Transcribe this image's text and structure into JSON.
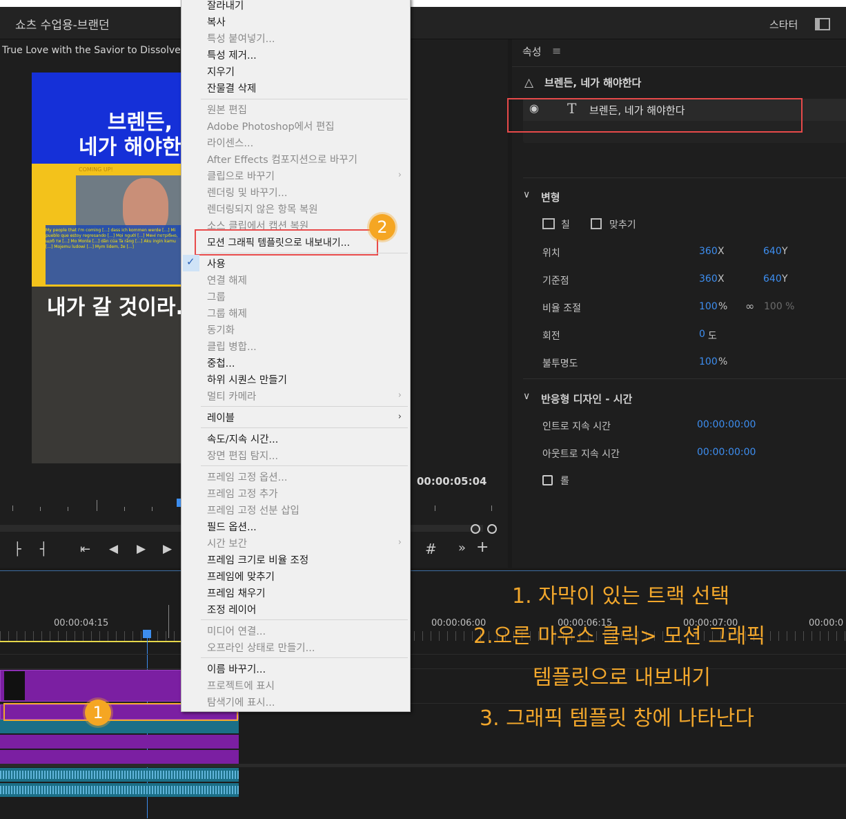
{
  "header": {
    "sequence_title": "쇼츠 수업용-브랜던",
    "workspace": "스타터"
  },
  "monitor": {
    "clip_title": "True Love with the Savior to Dissolve Ca",
    "preview_title_line1": "브렌든,",
    "preview_title_line2": "네가 해야한",
    "preview_bottom_text": "내가 갈 것이라.",
    "preview_coming_up": "COMING UP!",
    "preview_subtitles": "My people that I'm coming [...] dass ich kommen werde [...] Mi pueblo que estoy regresando [...] Mọi người [...] Мені потрібно, щоб ти [...] Mo Monte [...] dân của Ta rằng [...] Aku ingin kamu [...] Mojemu ludowi [...] Mym lidem, že [...]",
    "timecode": "00:00:05:04"
  },
  "properties": {
    "panel_title": "속성",
    "layer_name": "브렌든, 네가 해야한다",
    "text_layer": "브렌든, 네가 해야한다",
    "transform_title": "변형",
    "fill_label": "칠",
    "fit_label": "맞추기",
    "position_label": "위치",
    "position_x": "360",
    "position_y": "640",
    "anchor_label": "기준점",
    "anchor_x": "360",
    "anchor_y": "640",
    "scale_label": "비율 조절",
    "scale_value": "100",
    "scale_value2": "100 %",
    "rotation_label": "회전",
    "rotation_value": "0",
    "rotation_unit": "도",
    "opacity_label": "불투명도",
    "opacity_value": "100",
    "x_unit": "X",
    "y_unit": "Y",
    "pct_unit": "%",
    "responsive_title": "반응형 디자인 - 시간",
    "intro_label": "인트로 지속 시간",
    "intro_value": "00:00:00:00",
    "outro_label": "아웃트로 지속 시간",
    "outro_value": "00:00:00:00",
    "roll_label": "롤"
  },
  "timeline": {
    "tc1": "00:00:04:15",
    "tc2": "00:00:06:00",
    "tc3": "00:00:06:15",
    "tc4": "00:00:07:00",
    "tc5": "00:00:0"
  },
  "context_menu": {
    "items": [
      "잘라내기",
      "복사",
      "특성 붙여넣기...",
      "특성 제거...",
      "지우기",
      "잔물결 삭제",
      "원본 편집",
      "Adobe Photoshop에서 편집",
      "라이센스...",
      "After Effects 컴포지션으로 바꾸기",
      "클립으로 바꾸기",
      "렌더링 및 바꾸기...",
      "렌더링되지 않은 항목 복원",
      "소스 클립에서 캡션 복원",
      "모션 그래픽 템플릿으로 내보내기...",
      "사용",
      "연결 해제",
      "그룹",
      "그룹 해제",
      "동기화",
      "클립 병합...",
      "중첩...",
      "하위 시퀀스 만들기",
      "멀티 카메라",
      "레이블",
      "속도/지속 시간...",
      "장면 편집 탐지...",
      "프레임 고정 옵션...",
      "프레임 고정 추가",
      "프레임 고정 선분 삽입",
      "필드 옵션...",
      "시간 보간",
      "프레임 크기로 비율 조정",
      "프레임에 맞추기",
      "프레임 채우기",
      "조정 레이어",
      "미디어 연결...",
      "오프라인 상태로 만들기...",
      "이름 바꾸기...",
      "프로젝트에 표시",
      "탐색기에 표시..."
    ]
  },
  "annotations": {
    "badge1": "1",
    "badge2": "2",
    "step1": "1. 자막이 있는 트랙 선택",
    "step2": "2.오른 마우스 클릭> 모션 그래픽",
    "step2b": "템플릿으로 내보내기",
    "step3": "3. 그래픽 템플릿 창에 나타난다"
  },
  "colors": {
    "accent_blue": "#3d8ef0",
    "annotation_orange": "#f2a72c",
    "highlight_red": "#e84a4a",
    "clip_purple": "#7b1fa2",
    "audio_teal": "#1b6f87"
  }
}
